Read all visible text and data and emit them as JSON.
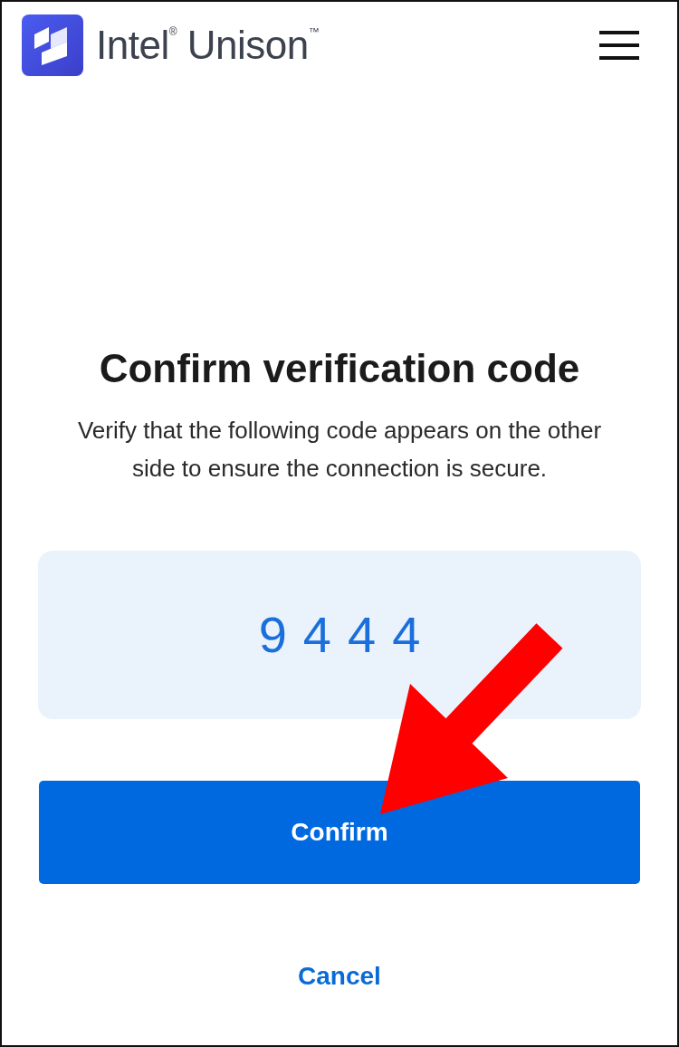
{
  "header": {
    "brand": "Intel$^{®}$ Unison$^{™}$"
  },
  "title": "Confirm verification code",
  "description": "Verify that the following code appears on the other side to ensure the connection is secure.",
  "code": "9444",
  "buttons": [
    {
      "label": "Confirm",
      "kind": "primary"
    },
    {
      "label": "Cancel",
      "kind": "link"
    }
  ]
}
